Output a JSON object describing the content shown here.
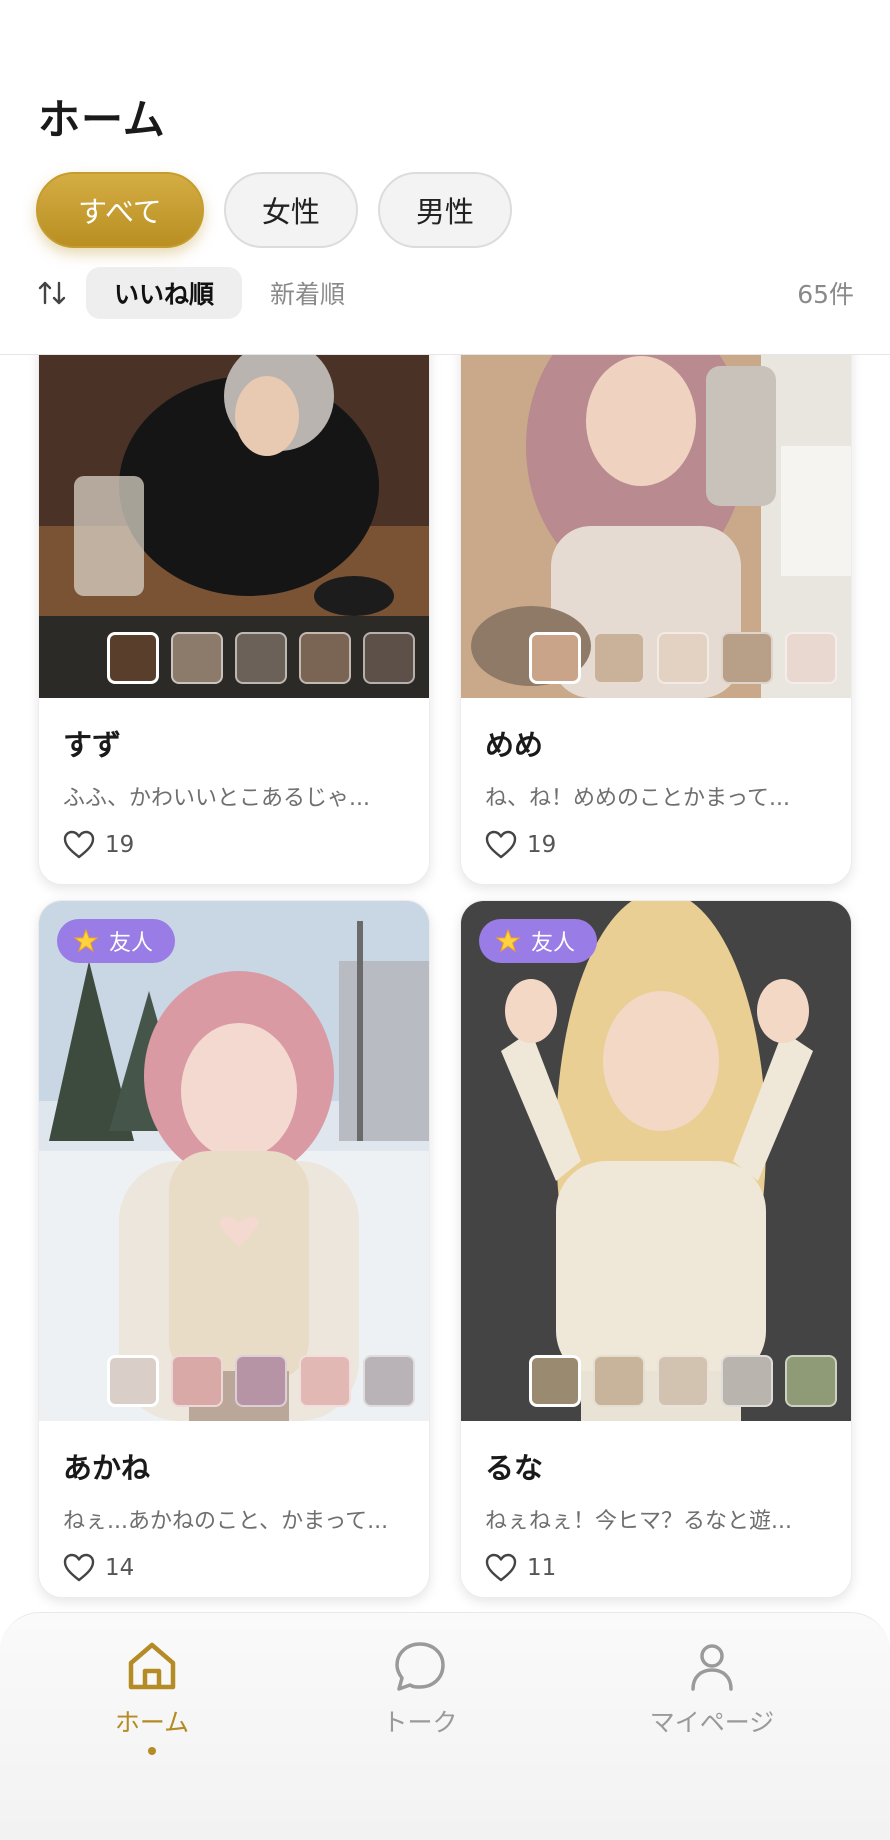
{
  "header": {
    "title": "ホーム"
  },
  "filters": {
    "all": "すべて",
    "female": "女性",
    "male": "男性"
  },
  "sort": {
    "likes": "いいね順",
    "newest": "新着順",
    "count": "65件"
  },
  "cards": [
    {
      "name": "すず",
      "message": "ふふ、かわいいとこあるじゃ...",
      "likes": "19",
      "badge": ""
    },
    {
      "name": "めめ",
      "message": "ね、ね！めめのことかまって...",
      "likes": "19",
      "badge": ""
    },
    {
      "name": "あかね",
      "message": "ねぇ...あかねのこと、かまって...",
      "likes": "14",
      "badge": "友人"
    },
    {
      "name": "るな",
      "message": "ねぇねぇ！今ヒマ？るなと遊...",
      "likes": "11",
      "badge": "友人"
    }
  ],
  "nav": {
    "home": "ホーム",
    "talk": "トーク",
    "mypage": "マイページ"
  },
  "colors": {
    "accent": "#b98f22",
    "badge": "#9a7ce6"
  }
}
